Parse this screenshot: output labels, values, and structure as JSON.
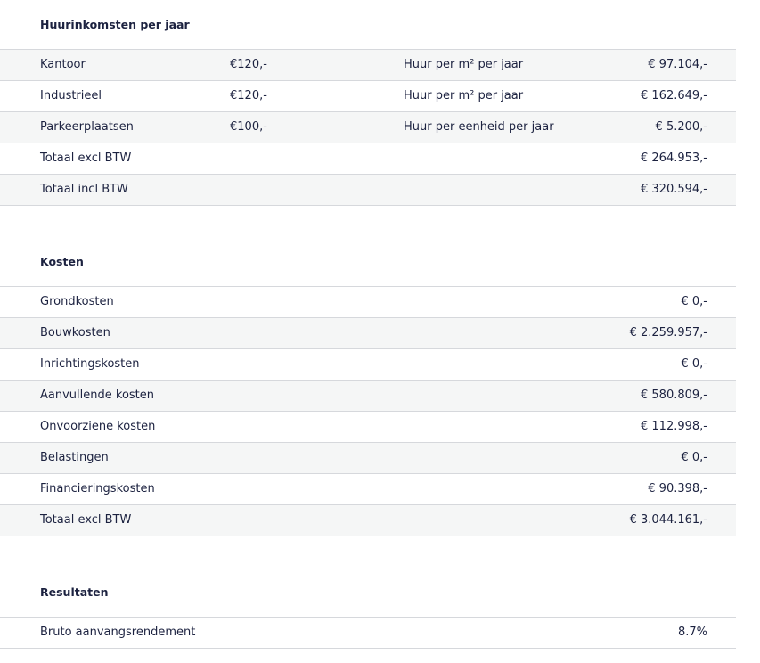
{
  "income": {
    "title": "Huurinkomsten per jaar",
    "rows": [
      {
        "label": "Kantoor",
        "price": "€120,-",
        "unit": "Huur per m² per jaar",
        "amount": "€ 97.104,-"
      },
      {
        "label": "Industrieel",
        "price": "€120,-",
        "unit": "Huur per m² per jaar",
        "amount": "€ 162.649,-"
      },
      {
        "label": "Parkeerplaatsen",
        "price": "€100,-",
        "unit": "Huur per eenheid per jaar",
        "amount": "€ 5.200,-"
      },
      {
        "label": "Totaal excl BTW",
        "price": "",
        "unit": "",
        "amount": "€ 264.953,-"
      },
      {
        "label": "Totaal incl BTW",
        "price": "",
        "unit": "",
        "amount": "€ 320.594,-"
      }
    ]
  },
  "costs": {
    "title": "Kosten",
    "rows": [
      {
        "label": "Grondkosten",
        "amount": "€ 0,-"
      },
      {
        "label": "Bouwkosten",
        "amount": "€ 2.259.957,-"
      },
      {
        "label": "Inrichtingskosten",
        "amount": "€ 0,-"
      },
      {
        "label": "Aanvullende kosten",
        "amount": "€ 580.809,-"
      },
      {
        "label": "Onvoorziene kosten",
        "amount": "€ 112.998,-"
      },
      {
        "label": "Belastingen",
        "amount": "€ 0,-"
      },
      {
        "label": "Financieringskosten",
        "amount": "€ 90.398,-"
      },
      {
        "label": "Totaal excl BTW",
        "amount": "€ 3.044.161,-"
      }
    ]
  },
  "results": {
    "title": "Resultaten",
    "rows": [
      {
        "label": "Bruto aanvangsrendement",
        "amount": "8.7%"
      }
    ]
  }
}
